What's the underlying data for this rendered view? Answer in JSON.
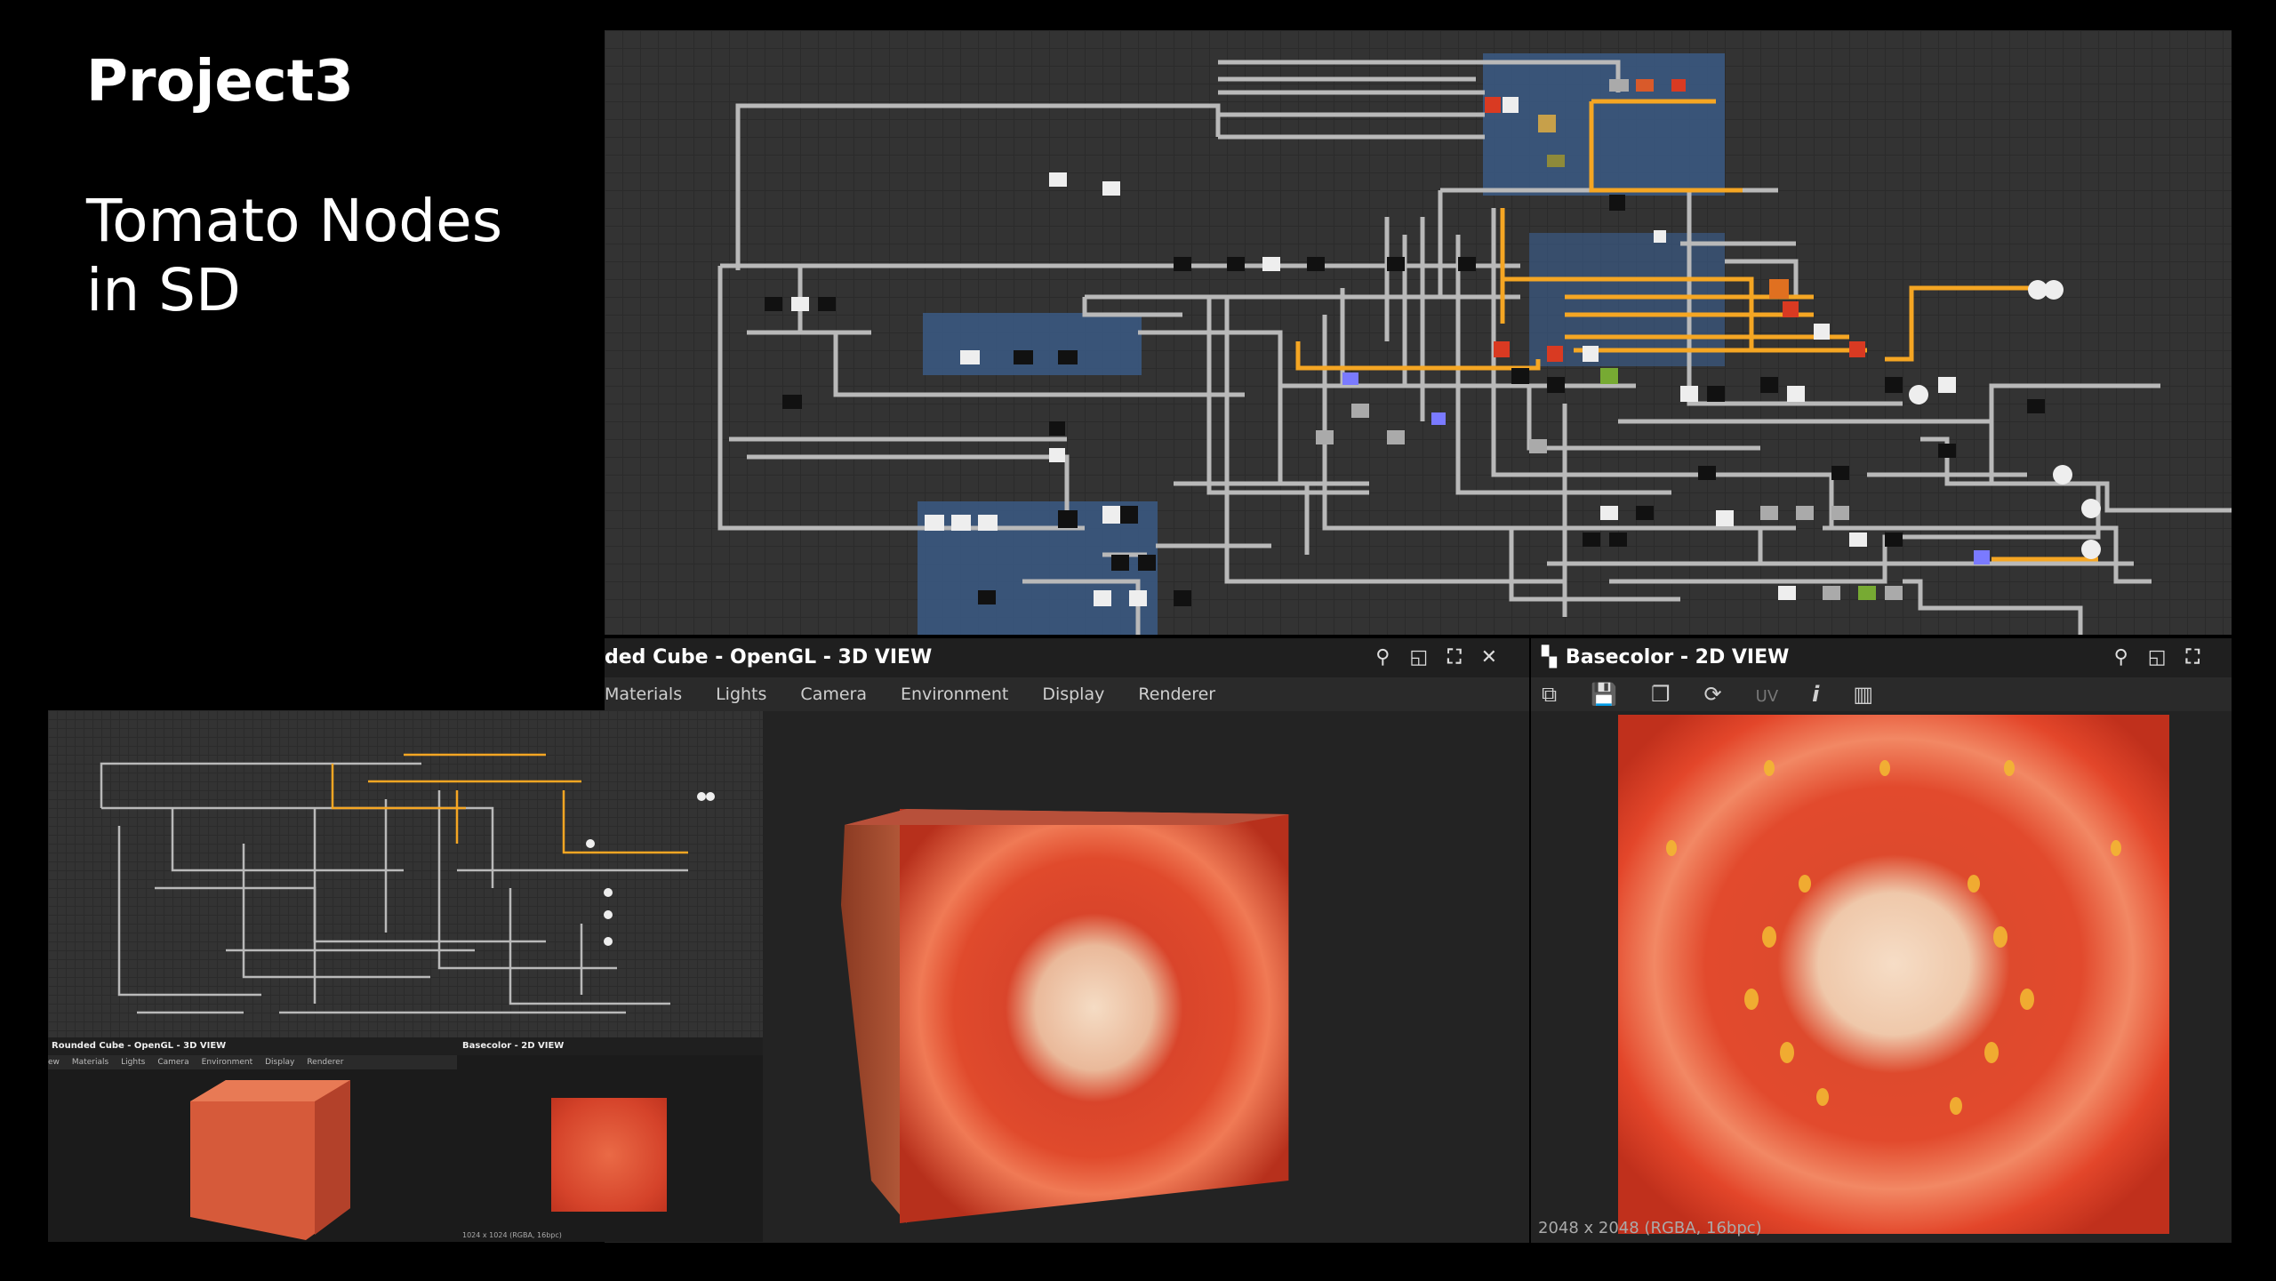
{
  "slide": {
    "title": "Project3",
    "subtitle_line1": "Tomato Nodes",
    "subtitle_line2": "in SD"
  },
  "view3d": {
    "title": "ded Cube - OpenGL - 3D VIEW",
    "menu": [
      "Materials",
      "Lights",
      "Camera",
      "Environment",
      "Display",
      "Renderer"
    ]
  },
  "view2d": {
    "title": "Basecolor - 2D VIEW",
    "uv_label": "UV",
    "info_icon": "i",
    "status": "2048 x 2048 (RGBA, 16bpc)"
  },
  "mini": {
    "view3d_title": "Rounded Cube - OpenGL - 3D VIEW",
    "view3d_menu": [
      "ew",
      "Materials",
      "Lights",
      "Camera",
      "Environment",
      "Display",
      "Renderer"
    ],
    "view2d_title": "Basecolor - 2D VIEW",
    "view2d_status": "1024 x 1024 (RGBA, 16bpc)"
  },
  "colors": {
    "frame": "#3b5a85",
    "wire": "#b9b9b9",
    "wire_active": "#f5a623",
    "tomato_red": "#d93a22",
    "tomato_flesh": "#f0d2b5",
    "seed": "#f2b632"
  },
  "icons": [
    "pin-icon",
    "float-icon",
    "maximize-icon",
    "close-icon",
    "checker-icon",
    "save-icon",
    "copy-icon",
    "refresh-icon",
    "info-icon",
    "histogram-icon"
  ]
}
